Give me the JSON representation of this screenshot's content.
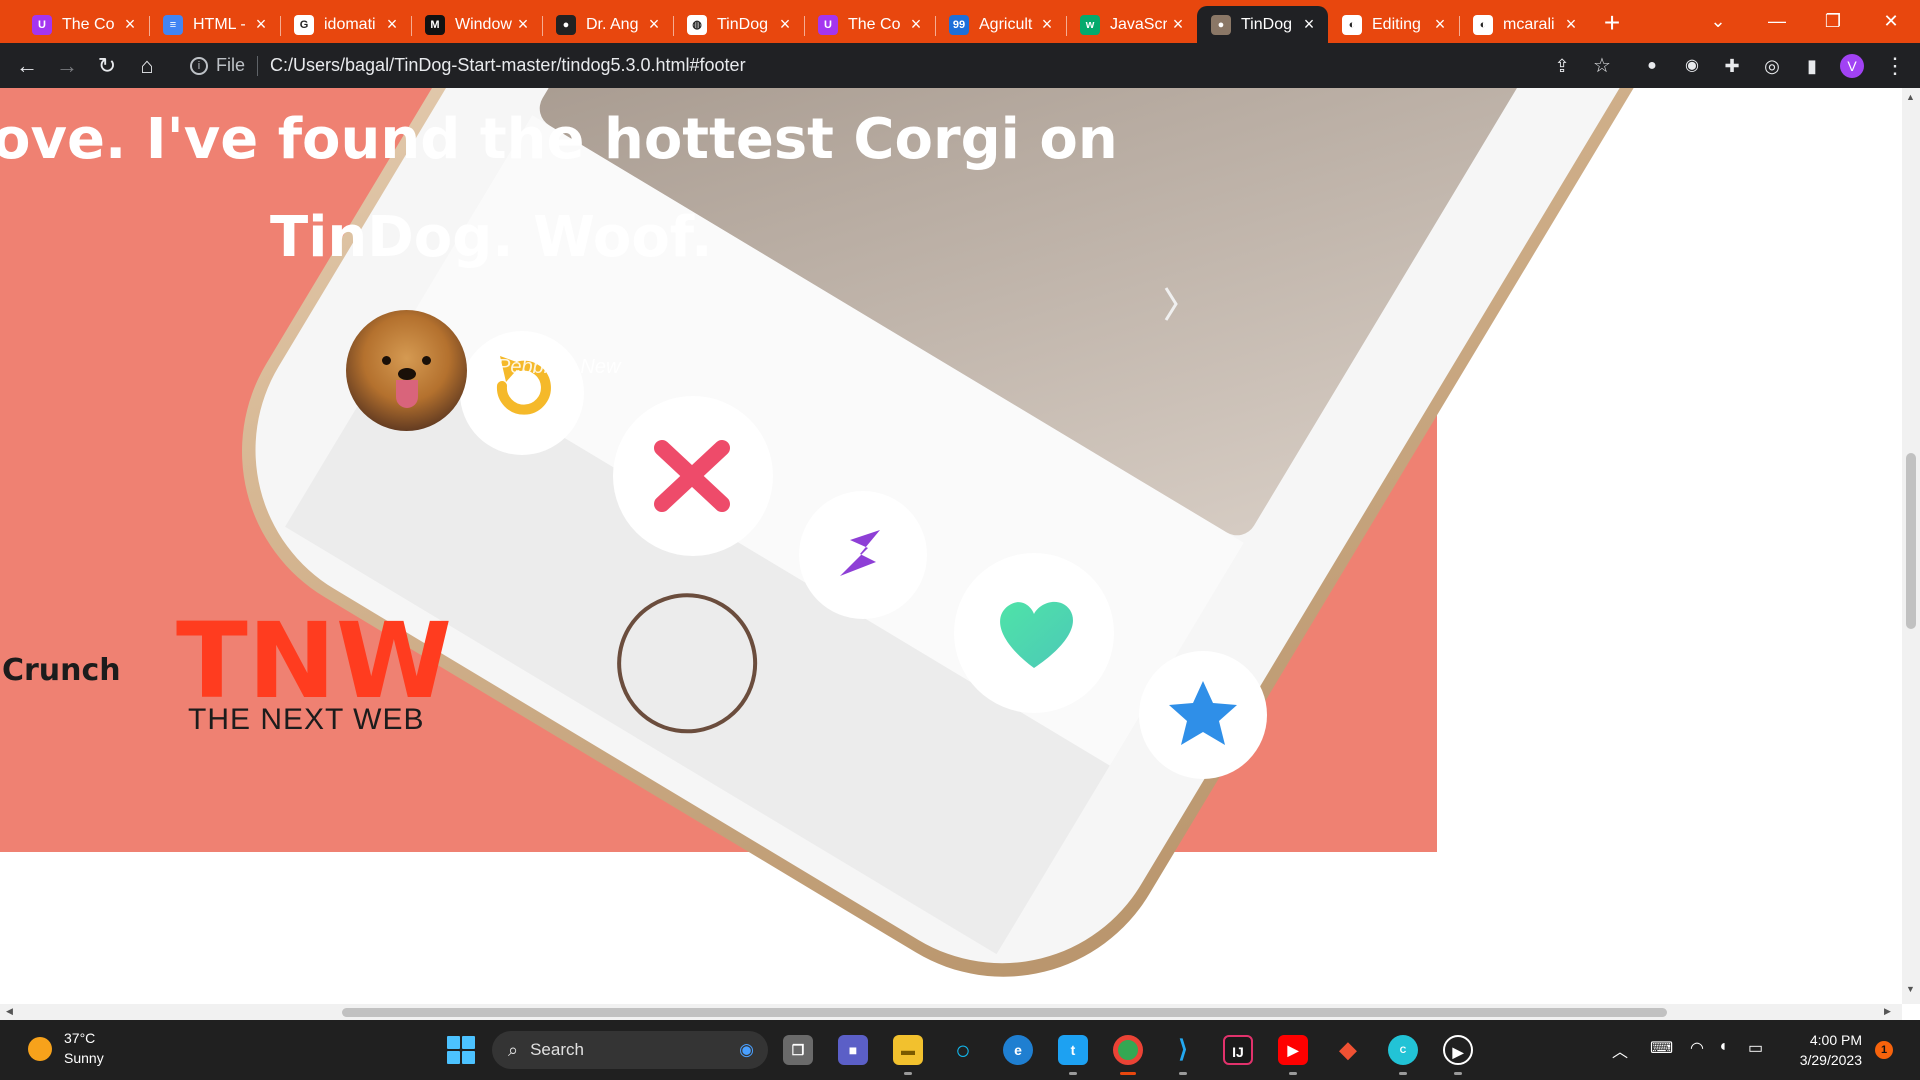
{
  "browser": {
    "tabs": [
      {
        "label": "The Co",
        "favicon": "udemy-icon",
        "color": "#a435f0",
        "glyph": "U"
      },
      {
        "label": "HTML -",
        "favicon": "docs-icon",
        "color": "#4285f4",
        "glyph": "≡"
      },
      {
        "label": "idomati",
        "favicon": "google-icon",
        "color": "#ffffff",
        "glyph": "G"
      },
      {
        "label": "Window",
        "favicon": "medium-icon",
        "color": "#111111",
        "glyph": "M"
      },
      {
        "label": "Dr. Ang",
        "favicon": "appbrewery-icon",
        "color": "#222222",
        "glyph": "●"
      },
      {
        "label": "TinDog",
        "favicon": "globe-icon",
        "color": "#ffffff",
        "glyph": "◍"
      },
      {
        "label": "The Co",
        "favicon": "udemy-icon",
        "color": "#a435f0",
        "glyph": "U"
      },
      {
        "label": "Agricult",
        "favicon": "99-icon",
        "color": "#1e6fd9",
        "glyph": "99"
      },
      {
        "label": "JavaScri",
        "favicon": "w3-icon",
        "color": "#04aa6d",
        "glyph": "w"
      },
      {
        "label": "TinDog",
        "favicon": "dog-icon",
        "color": "#8a7766",
        "glyph": "●",
        "active": true
      },
      {
        "label": "Editing",
        "favicon": "github-icon",
        "color": "#ffffff",
        "glyph": "◐"
      },
      {
        "label": "mcarali",
        "favicon": "github-icon",
        "color": "#ffffff",
        "glyph": "◐"
      }
    ],
    "new_tab": "+",
    "address_prefix": "File",
    "url": "C:/Users/bagal/TinDog-Start-master/tindog5.3.0.html#footer",
    "profile_initial": "V"
  },
  "page": {
    "quote_line1": "ove. I've found the hottest Corgi on",
    "quote_line2": "TinDog. Woof.",
    "author": "Pebbles, New",
    "press_partial": "Crunch",
    "press_tnw_mark": "TNW",
    "press_tnw": "THE NEXT WEB"
  },
  "taskbar": {
    "temperature": "37°C",
    "condition": "Sunny",
    "search_label": "Search",
    "time": "4:00 PM",
    "date": "3/29/2023",
    "notifications": "1"
  },
  "colors": {
    "tab_strip": "#e8470e",
    "toolbar": "#202124",
    "coral": "#ef8172",
    "taskbar": "#202020"
  }
}
